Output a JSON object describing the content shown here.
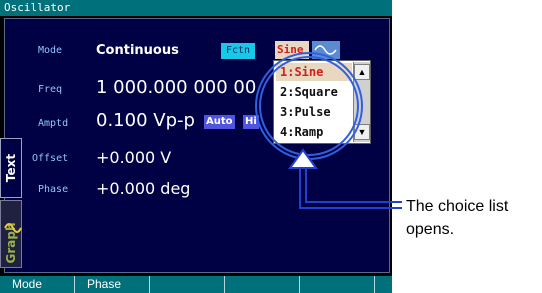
{
  "window": {
    "title": "Oscillator"
  },
  "params": {
    "mode": {
      "label": "Mode",
      "value": "Continuous"
    },
    "freq": {
      "label": "Freq",
      "value": "1 000.000 000 00"
    },
    "amptd": {
      "label": "Amptd",
      "value": "0.100 Vp-p",
      "auto_badge": "Auto",
      "hi_badge": "Hi"
    },
    "offset": {
      "label": "Offset",
      "value": "+0.000 V"
    },
    "phase": {
      "label": "Phase",
      "value": "+0.000 deg"
    }
  },
  "function": {
    "fctn_label": "Fctn",
    "current_value": "Sine",
    "options": [
      "1:Sine",
      "2:Square",
      "3:Pulse",
      "4:Ramp"
    ],
    "selected_index": 0
  },
  "side_tabs": {
    "text": "Text",
    "graph": "Graph"
  },
  "callout": {
    "line1": "The choice list",
    "line2": "opens."
  },
  "softkeys": [
    "Mode",
    "Phase",
    "",
    "",
    "",
    ""
  ],
  "colors": {
    "title_bar": "#00707a",
    "panel": "#000044",
    "label": "#8fc8ff",
    "fctn_button": "#18c8e8",
    "selected_item_bg": "#e8d8c0",
    "selected_item_text": "#d02020",
    "badge": "#5055e0",
    "callout_circle": "#3060e0"
  }
}
